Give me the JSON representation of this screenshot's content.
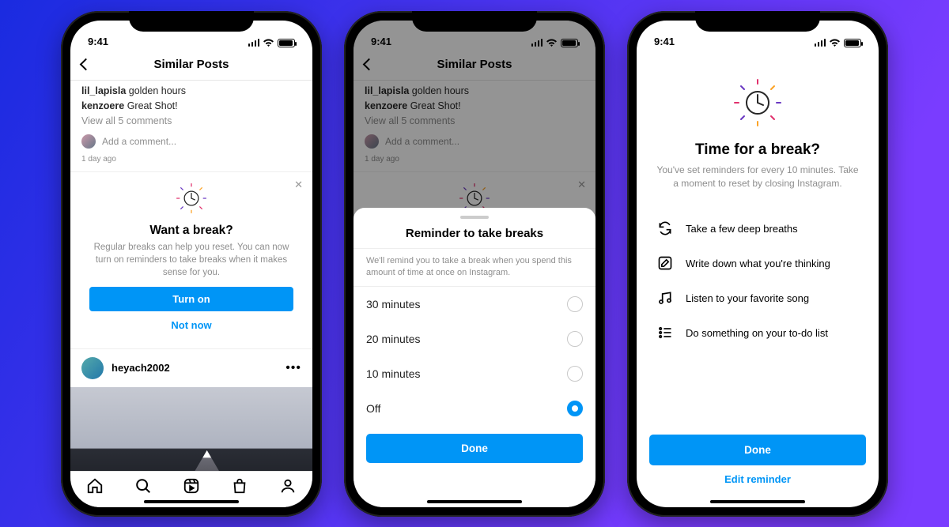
{
  "status": {
    "time": "9:41"
  },
  "p1": {
    "header_title": "Similar Posts",
    "comment1_user": "lil_lapisla",
    "comment1_text": "golden hours",
    "comment2_user": "kenzoere",
    "comment2_text": "Great Shot!",
    "view_all": "View all 5 comments",
    "add_comment": "Add a comment...",
    "timestamp": "1 day ago",
    "card_title": "Want a break?",
    "card_body": "Regular breaks can help you reset. You can now turn on reminders to take breaks when it makes sense for you.",
    "turn_on": "Turn on",
    "not_now": "Not now",
    "next_user": "heyach2002"
  },
  "p2": {
    "sheet_title": "Reminder to take breaks",
    "sheet_sub": "We'll remind you to take a break when you spend this amount of time at once on Instagram.",
    "opts": [
      "30 minutes",
      "20 minutes",
      "10 minutes",
      "Off"
    ],
    "selected": "Off",
    "done": "Done"
  },
  "p3": {
    "title": "Time for a break?",
    "body": "You've set reminders for every 10 minutes. Take a moment to reset by closing Instagram.",
    "tips": [
      "Take a few deep breaths",
      "Write down what you're thinking",
      "Listen to your favorite song",
      "Do something on your to-do list"
    ],
    "done": "Done",
    "edit": "Edit reminder"
  }
}
